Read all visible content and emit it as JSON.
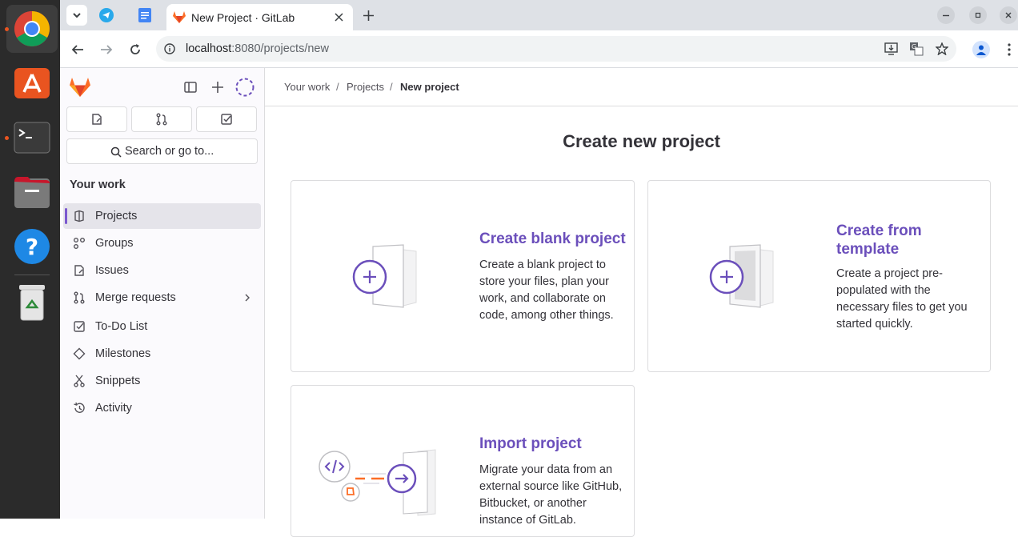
{
  "browser": {
    "tab_title": "New Project · GitLab",
    "url_host": "localhost",
    "url_path": ":8080/projects/new"
  },
  "dock": {
    "items": [
      "chrome-icon",
      "app-center-icon",
      "terminal-icon",
      "files-icon",
      "help-icon",
      "trash-icon"
    ]
  },
  "sidebar": {
    "search_label": "Search or go to...",
    "section_title": "Your work",
    "items": [
      {
        "label": "Projects",
        "icon": "project-icon",
        "active": true
      },
      {
        "label": "Groups",
        "icon": "group-icon"
      },
      {
        "label": "Issues",
        "icon": "issue-icon"
      },
      {
        "label": "Merge requests",
        "icon": "merge-request-icon"
      },
      {
        "label": "To-Do List",
        "icon": "todo-icon"
      },
      {
        "label": "Milestones",
        "icon": "milestone-icon"
      },
      {
        "label": "Snippets",
        "icon": "snippet-icon"
      },
      {
        "label": "Activity",
        "icon": "history-icon"
      }
    ]
  },
  "breadcrumb": {
    "items": [
      "Your work",
      "Projects",
      "New project"
    ]
  },
  "main": {
    "title": "Create new project",
    "cards": [
      {
        "title": "Create blank project",
        "description": "Create a blank project to store your files, plan your work, and collaborate on code, among other things."
      },
      {
        "title_line1": "Create from",
        "title_line2": "template",
        "description": "Create a project pre-populated with the necessary files to get you started quickly."
      },
      {
        "title": "Import project",
        "description": "Migrate your data from an external source like GitHub, Bitbucket, or another instance of GitLab."
      }
    ]
  },
  "colors": {
    "accent": "#6b4fbb",
    "gitlab_orange": "#fc6d26"
  }
}
